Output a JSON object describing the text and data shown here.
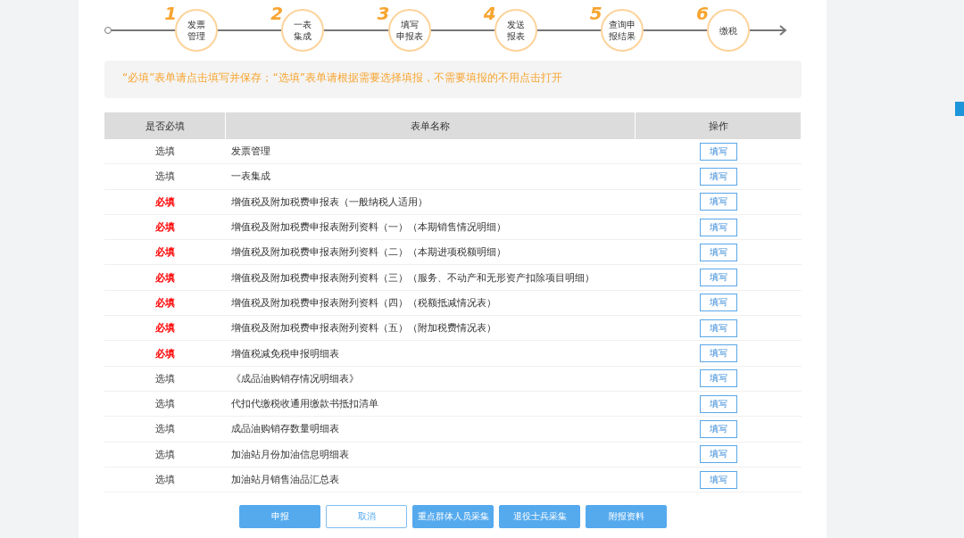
{
  "steps": [
    {
      "number": "1",
      "label_lines": [
        "发票",
        "管理"
      ]
    },
    {
      "number": "2",
      "label_lines": [
        "一表",
        "集成"
      ]
    },
    {
      "number": "3",
      "label_lines": [
        "填写",
        "申报表"
      ]
    },
    {
      "number": "4",
      "label_lines": [
        "发送",
        "报表"
      ]
    },
    {
      "number": "5",
      "label_lines": [
        "查询申",
        "报结果"
      ]
    },
    {
      "number": "6",
      "label_lines": [
        "缴税"
      ]
    }
  ],
  "notice": "“必填”表单请点击填写并保存；“选填”表单请根据需要选择填报，不需要填报的不用点击打开",
  "table": {
    "columns": [
      "是否必填",
      "表单名称",
      "操作"
    ],
    "rows": [
      {
        "required_label": "选填",
        "required": false,
        "name": "发票管理",
        "action": "填写"
      },
      {
        "required_label": "选填",
        "required": false,
        "name": "一表集成",
        "action": "填写"
      },
      {
        "required_label": "必填",
        "required": true,
        "name": "增值税及附加税费申报表（一般纳税人适用）",
        "action": "填写"
      },
      {
        "required_label": "必填",
        "required": true,
        "name": "增值税及附加税费申报表附列资料（一）（本期销售情况明细）",
        "action": "填写"
      },
      {
        "required_label": "必填",
        "required": true,
        "name": "增值税及附加税费申报表附列资料（二）（本期进项税额明细）",
        "action": "填写"
      },
      {
        "required_label": "必填",
        "required": true,
        "name": "增值税及附加税费申报表附列资料（三）（服务、不动产和无形资产扣除项目明细）",
        "action": "填写"
      },
      {
        "required_label": "必填",
        "required": true,
        "name": "增值税及附加税费申报表附列资料（四）（税额抵减情况表）",
        "action": "填写"
      },
      {
        "required_label": "必填",
        "required": true,
        "name": "增值税及附加税费申报表附列资料（五）（附加税费情况表）",
        "action": "填写"
      },
      {
        "required_label": "必填",
        "required": true,
        "name": "增值税减免税申报明细表",
        "action": "填写"
      },
      {
        "required_label": "选填",
        "required": false,
        "name": "《成品油购销存情况明细表》",
        "action": "填写"
      },
      {
        "required_label": "选填",
        "required": false,
        "name": "代扣代缴税收通用缴款书抵扣清单",
        "action": "填写"
      },
      {
        "required_label": "选填",
        "required": false,
        "name": "成品油购销存数量明细表",
        "action": "填写"
      },
      {
        "required_label": "选填",
        "required": false,
        "name": "加油站月份加油信息明细表",
        "action": "填写"
      },
      {
        "required_label": "选填",
        "required": false,
        "name": "加油站月销售油品汇总表",
        "action": "填写"
      }
    ]
  },
  "buttons": [
    {
      "label": "申报",
      "kind": "primary"
    },
    {
      "label": "取消",
      "kind": "outline"
    },
    {
      "label": "重点群体人员采集",
      "kind": "primary"
    },
    {
      "label": "退役士兵采集",
      "kind": "primary"
    },
    {
      "label": "附报资料",
      "kind": "primary"
    }
  ]
}
